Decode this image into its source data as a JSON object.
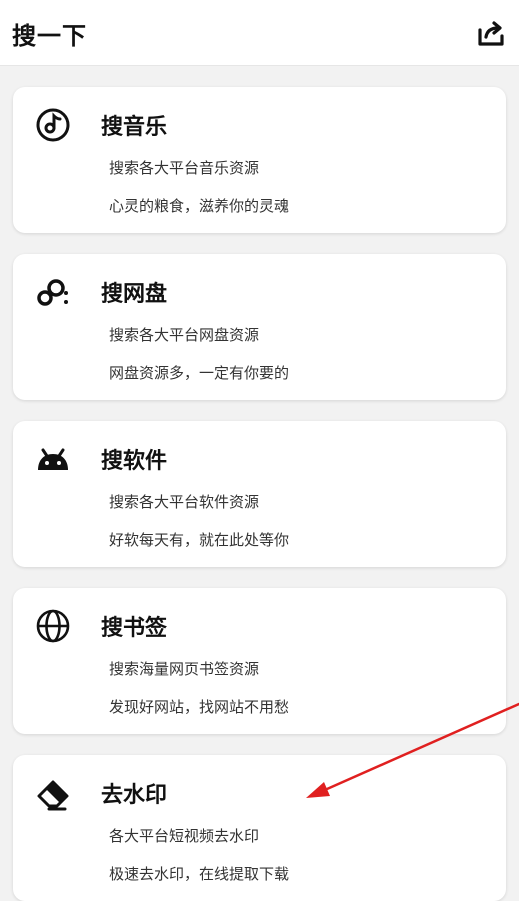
{
  "header": {
    "title": "搜一下",
    "share_icon": "share-icon"
  },
  "cards": [
    {
      "icon": "music-note-icon",
      "title": "搜音乐",
      "line1": "搜索各大平台音乐资源",
      "line2": "心灵的粮食，滋养你的灵魂"
    },
    {
      "icon": "cloud-share-icon",
      "title": "搜网盘",
      "line1": "搜索各大平台网盘资源",
      "line2": "网盘资源多，一定有你要的"
    },
    {
      "icon": "android-icon",
      "title": "搜软件",
      "line1": "搜索各大平台软件资源",
      "line2": "好软每天有，就在此处等你"
    },
    {
      "icon": "globe-icon",
      "title": "搜书签",
      "line1": "搜索海量网页书签资源",
      "line2": "发现好网站，找网站不用愁"
    },
    {
      "icon": "eraser-icon",
      "title": "去水印",
      "line1": "各大平台短视频去水印",
      "line2": "极速去水印，在线提取下载"
    }
  ],
  "colors": {
    "background": "#f2f2f2",
    "card": "#ffffff",
    "annotation_arrow": "#e02020"
  }
}
